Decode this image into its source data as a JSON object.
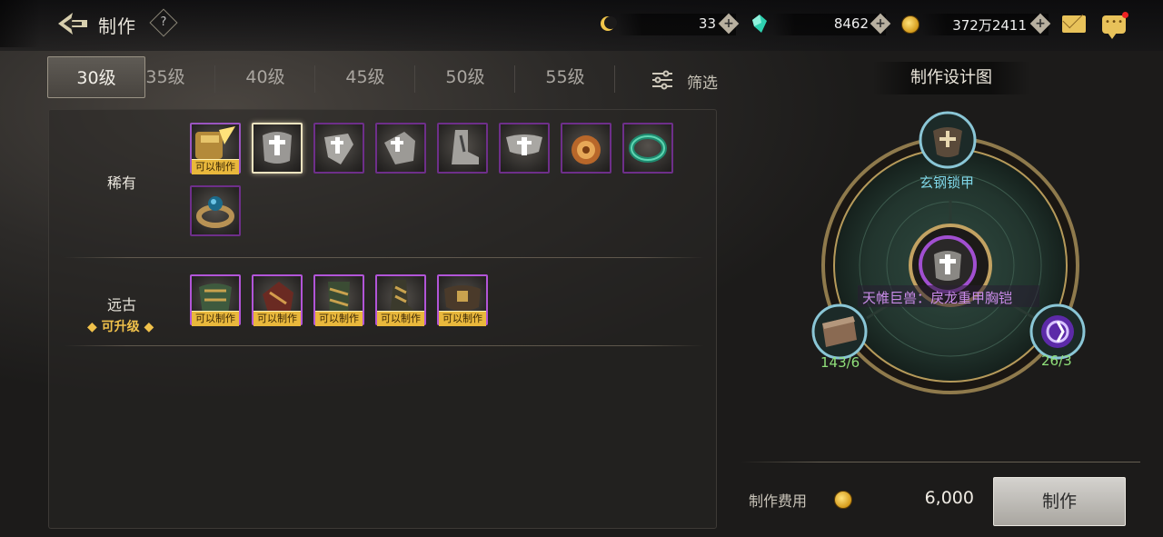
{
  "header": {
    "title": "制作",
    "help_symbol": "?",
    "resources": [
      {
        "name": "energy",
        "icon": "crescent-icon",
        "value": "33"
      },
      {
        "name": "gems",
        "icon": "gem-icon",
        "value": "8462"
      },
      {
        "name": "gold",
        "icon": "gold-coin-icon",
        "value": "372万2411"
      }
    ],
    "plus_symbol": "+"
  },
  "tabs": {
    "items": [
      "30级",
      "35级",
      "40级",
      "45级",
      "50级",
      "55级"
    ],
    "active_index": 0,
    "filter_label": "筛选"
  },
  "categories": {
    "rare": {
      "label": "稀有",
      "items": [
        {
          "icon": "gauntlet-icon",
          "badge": "可以制作"
        },
        {
          "icon": "chest-armor-icon",
          "badge": "",
          "selected": true
        },
        {
          "icon": "shoulder-armor-icon",
          "badge": ""
        },
        {
          "icon": "gloves-icon",
          "badge": ""
        },
        {
          "icon": "boots-icon",
          "badge": ""
        },
        {
          "icon": "belt-armor-icon",
          "badge": ""
        },
        {
          "icon": "amulet-icon",
          "badge": ""
        },
        {
          "icon": "bracelet-icon",
          "badge": ""
        },
        {
          "icon": "ring-icon",
          "badge": ""
        }
      ]
    },
    "ancient": {
      "label": "远古",
      "tag": "◆ 可升级 ◆",
      "items": [
        {
          "icon": "ancient-chest-icon",
          "badge": "可以制作"
        },
        {
          "icon": "ancient-gloves-icon",
          "badge": "可以制作"
        },
        {
          "icon": "ancient-leggings-icon",
          "badge": "可以制作"
        },
        {
          "icon": "ancient-boots-icon",
          "badge": "可以制作"
        },
        {
          "icon": "ancient-belt-icon",
          "badge": "可以制作"
        }
      ]
    }
  },
  "blueprint": {
    "title": "制作设计图",
    "top_material": {
      "name": "玄钢锁甲",
      "plus": "+"
    },
    "center_item": {
      "name": "天帷巨兽：戾龙重甲胸铠"
    },
    "left_material": {
      "count": "143/6"
    },
    "right_material": {
      "count": "26/3"
    }
  },
  "footer": {
    "cost_label": "制作费用",
    "cost_value": "6,000",
    "craft_button": "制作"
  },
  "colors": {
    "badge_gold": "#e9b83c",
    "epic_purple": "#6e2f8a",
    "material_cyan": "#7fd7e8",
    "item_purple_text": "#c98be8",
    "count_green": "#8fe07a"
  }
}
